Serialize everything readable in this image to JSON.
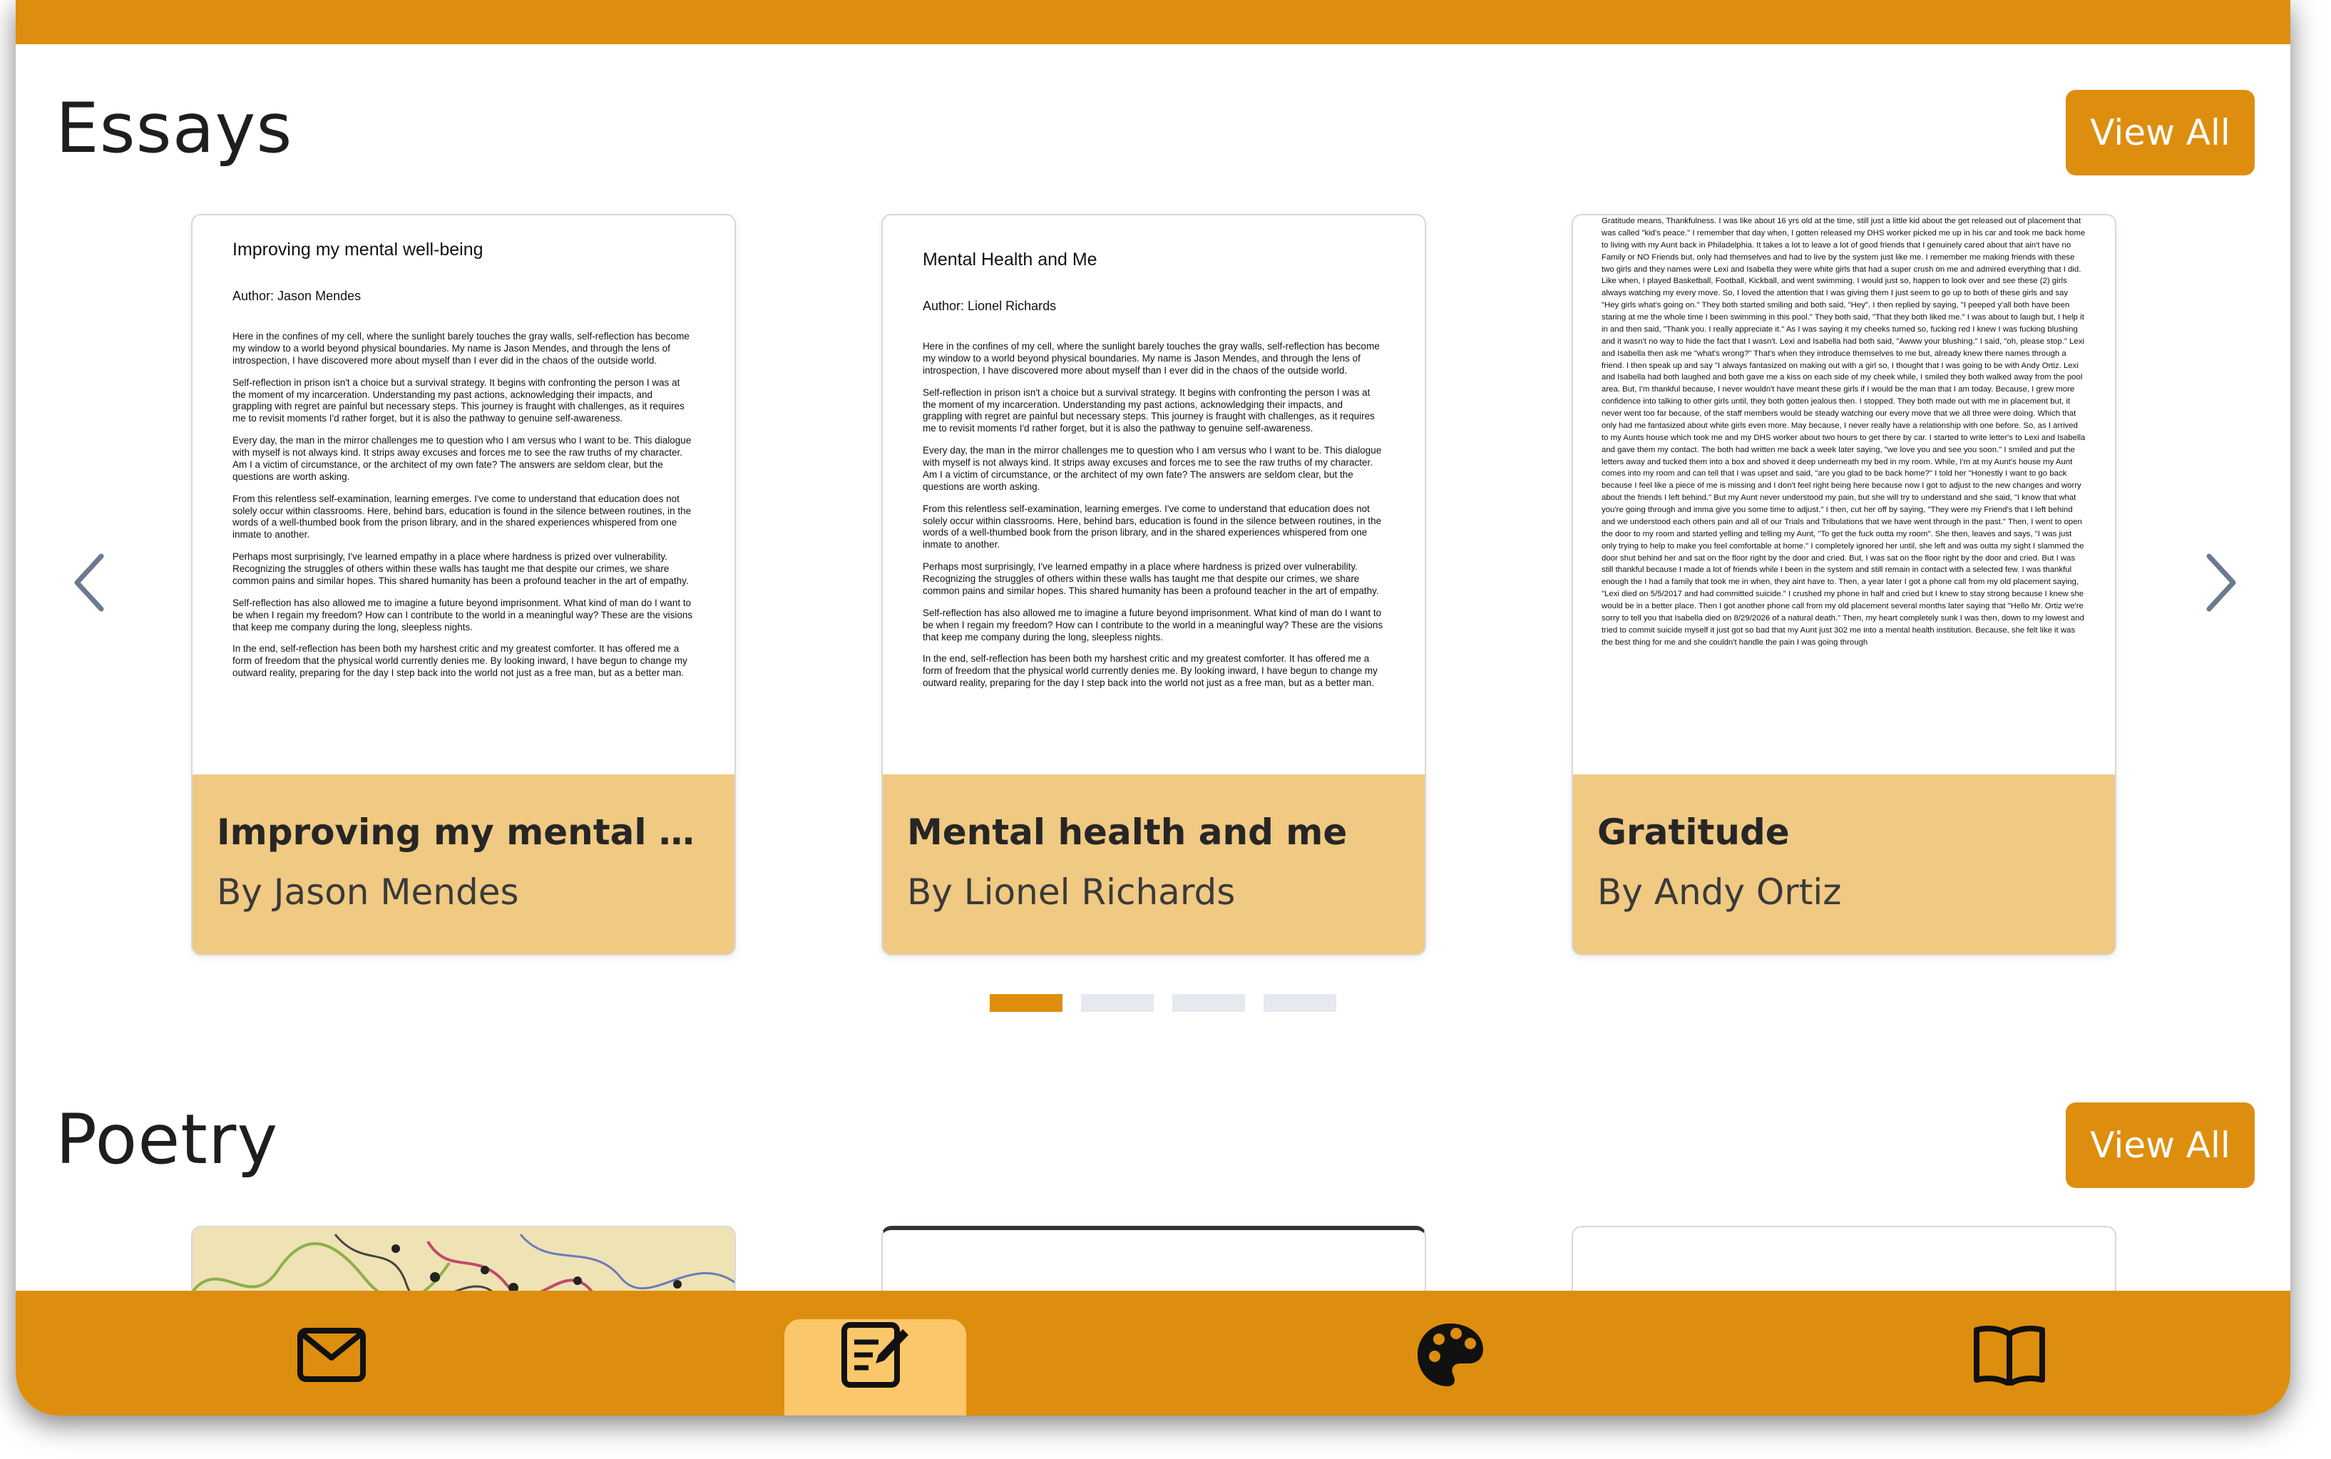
{
  "sections": {
    "essays": {
      "title": "Essays",
      "view_all_label": "View All",
      "cards": [
        {
          "card_title": "Improving my mental we...",
          "card_author": "By Jason Mendes",
          "doc_title": "Improving my mental well-being",
          "doc_author": "Author: Jason Mendes",
          "paragraphs": [
            "Here in the confines of my cell, where the sunlight barely touches the gray walls, self-reflection has become my window to a world beyond physical boundaries. My name is Jason Mendes, and through the lens of introspection, I have discovered more about myself than I ever did in the chaos of the outside world.",
            "Self-reflection in prison isn't a choice but a survival strategy. It begins with confronting the person I was at the moment of my incarceration. Understanding my past actions, acknowledging their impacts, and grappling with regret are painful but necessary steps. This journey is fraught with challenges, as it requires me to revisit moments I'd rather forget, but it is also the pathway to genuine self-awareness.",
            "Every day, the man in the mirror challenges me to question who I am versus who I want to be. This dialogue with myself is not always kind. It strips away excuses and forces me to see the raw truths of my character. Am I a victim of circumstance, or the architect of my own fate? The answers are seldom clear, but the questions are worth asking.",
            "From this relentless self-examination, learning emerges. I've come to understand that education does not solely occur within classrooms. Here, behind bars, education is found in the silence between routines, in the words of a well-thumbed book from the prison library, and in the shared experiences whispered from one inmate to another.",
            "Perhaps most surprisingly, I've learned empathy in a place where hardness is prized over vulnerability. Recognizing the struggles of others within these walls has taught me that despite our crimes, we share common pains and similar hopes. This shared humanity has been a profound teacher in the art of empathy.",
            "Self-reflection has also allowed me to imagine a future beyond imprisonment. What kind of man do I want to be when I regain my freedom? How can I contribute to the world in a meaningful way? These are the visions that keep me company during the long, sleepless nights.",
            "In the end, self-reflection has been both my harshest critic and my greatest comforter. It has offered me a form of freedom that the physical world currently denies me. By looking inward, I have begun to change my outward reality, preparing for the day I step back into the world not just as a free man, but as a better man."
          ]
        },
        {
          "card_title": "Mental health and me",
          "card_author": "By Lionel Richards",
          "doc_title": "Mental Health and Me",
          "doc_author": "Author: Lionel Richards",
          "paragraphs": [
            "Here in the confines of my cell, where the sunlight barely touches the gray walls, self-reflection has become my window to a world beyond physical boundaries. My name is Jason Mendes, and through the lens of introspection, I have discovered more about myself than I ever did in the chaos of the outside world.",
            "Self-reflection in prison isn't a choice but a survival strategy. It begins with confronting the person I was at the moment of my incarceration. Understanding my past actions, acknowledging their impacts, and grappling with regret are painful but necessary steps. This journey is fraught with challenges, as it requires me to revisit moments I'd rather forget, but it is also the pathway to genuine self-awareness.",
            "Every day, the man in the mirror challenges me to question who I am versus who I want to be. This dialogue with myself is not always kind. It strips away excuses and forces me to see the raw truths of my character. Am I a victim of circumstance, or the architect of my own fate? The answers are seldom clear, but the questions are worth asking.",
            "From this relentless self-examination, learning emerges. I've come to understand that education does not solely occur within classrooms. Here, behind bars, education is found in the silence between routines, in the words of a well-thumbed book from the prison library, and in the shared experiences whispered from one inmate to another.",
            "Perhaps most surprisingly, I've learned empathy in a place where hardness is prized over vulnerability. Recognizing the struggles of others within these walls has taught me that despite our crimes, we share common pains and similar hopes. This shared humanity has been a profound teacher in the art of empathy.",
            "Self-reflection has also allowed me to imagine a future beyond imprisonment. What kind of man do I want to be when I regain my freedom? How can I contribute to the world in a meaningful way? These are the visions that keep me company during the long, sleepless nights.",
            "In the end, self-reflection has been both my harshest critic and my greatest comforter. It has offered me a form of freedom that the physical world currently denies me. By looking inward, I have begun to change my outward reality, preparing for the day I step back into the world not just as a free man, but as a better man."
          ]
        },
        {
          "card_title": "Gratitude",
          "card_author": "By Andy Ortiz",
          "doc_text": "Gratitude means, Thankfulness. I was like about 16 yrs old at the time, still just a little kid about the get released out of placement that was called \"kid's peace.\" I remember that day when, I gotten released my DHS worker picked me up in his car and took me back home to living with my Aunt back in Philadelphia. It takes a lot to leave a lot of good friends that I genuinely cared about that ain't have no Family or NO Friends but, only had themselves and had to live by the system just like me. I remember me making friends with these two girls and they names were Lexi and Isabella they were white girls that had a super crush on me and admired everything that I did. Like when, I played Basketball, Football, Kickball, and went swimming. I would just so, happen to look over and see these (2) girls always watching my every move. So, I loved the attention that I was giving them I just seem to go up to both of these girls and say \"Hey girls what's going on.\" They both started smiling and both said, \"Hey\". I then replied by saying, \"I peeped y'all both have been staring at me the whole time I been swimming in this pool.\" They both said, \"That they both liked me.\" I was about to laugh but, I help it in and then said, \"Thank you. I really appreciate it.\" As I was saying it my cheeks turned so, fucking red I knew I was fucking blushing and it wasn't no way to hide the fact that I wasn't. Lexi and Isabella had both said, \"Awww your blushing.\" I said, \"oh, please stop.\" Lexi and Isabella then ask me \"what's wrong?\" That's when they introduce themselves to me but, already knew there names through a friend. I then speak up and say \"I always fantasized on making out with a girl so, I thought that I was going to be with Andy Ortiz. Lexi and Isabella had both laughed and both gave me a kiss on each side of my cheek while, I smiled they both walked away from the pool area. But, I'm thankful because, I never wouldn't have meant these girls if I would be the man that I am today. Because, I grew more confidence into talking to other girls until, they both gotten jealous then. I stopped. They both made out with me in placement but, it never went too far because, of the staff members would be steady watching our every move that we all three were doing. Which that only had me fantasized about white girls even more. May because, I never really have a relationship with one before. So, as I arrived to my Aunts house which took me and my DHS worker about two hours to get there by car. I started to write letter's to Lexi and Isabella and gave them my contact. The both had written me back a week later saying, \"we love you and see you soon.\" I smiled and put the letters away and tucked them into a box and shoved it deep underneath my bed in my room. While, I'm at my Aunt's house my Aunt comes into my room and can tell that I was upset and said, \"are you glad to be back home?\" I told her \"Honestly I want to go back because I feel like a piece of me is missing and I don't feel right being here because now I got to adjust to the new changes and worry about the friends I left behind.\" But my Aunt never understood my pain, but she will try to understand and she said, \"I know that what you're going through and imma give you some time to adjust.\" I then, cut her off by saying, \"They were my Friend's that I left behind and we understood each others pain and all of our Trials and Tribulations that we have went through in the past.\" Then, I went to open the door to my room and started yelling and telling my Aunt, \"To get the fuck outta my room\". She then, leaves and says, \"I was just only trying to help to make you feel comfortable at home.\" I completely ignored her until, she left and was outta my sight I slammed the door shut behind her and sat on the floor right by the door and cried. But, I was sat on the floor right by the door and cried. But I was still thankful because I made a lot of friends while I been in the system and still remain in contact with a selected few. I was thankful enough the I had a family that took me in when, they aint have to. Then, a year later I got a phone call from my old placement saying, \"Lexi died on 5/5/2017 and had committed suicide.\" I crushed my phone in half and cried but I knew to stay strong because I knew she would be in a better place. Then I got another phone call from my old placement several months later saying that \"Hello Mr. Ortiz we're sorry to tell you that Isabella died on 8/29/2026 of a natural death.\" Then, my heart completely sunk I was then, down to my lowest and tried to commit suicide myself it just got so bad that my Aunt just 302 me into a mental health institution. Because, she felt like it was the best thing for me and she couldn't handle the pain I was going through"
        }
      ]
    },
    "poetry": {
      "title": "Poetry",
      "view_all_label": "View All"
    }
  },
  "pagination": {
    "total": 4,
    "active_index": 0
  },
  "bottom_nav": [
    {
      "icon": "envelope-icon"
    },
    {
      "icon": "edit-document-icon",
      "selected": true
    },
    {
      "icon": "palette-icon"
    },
    {
      "icon": "book-icon"
    }
  ],
  "colors": {
    "accent": "#de8e0e",
    "card_meta_bg": "#f0c982",
    "nav_selected_bg": "#fbc76b",
    "pagination_inactive": "#e6e9f0"
  }
}
